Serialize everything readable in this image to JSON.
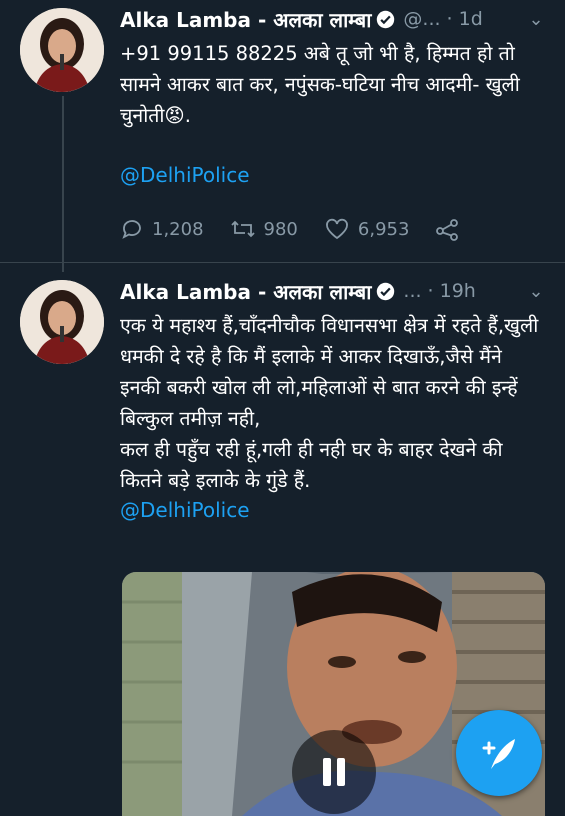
{
  "colors": {
    "background": "#15202b",
    "link": "#1da1f2",
    "muted": "#8899a6",
    "divider": "#38444d"
  },
  "tweets": [
    {
      "name": "Alka Lamba - अलका लाम्बा",
      "handle": "@...",
      "time": "· 1d",
      "text": "+91 99115 88225 अबे तू जो भी है, हिम्मत हो तो सामने आकर बात कर, नपुंसक-घटिया नीच आदमी- खुली चुनोती😡.",
      "mention": "@DelhiPolice",
      "replies": "1,208",
      "retweets": "980",
      "likes": "6,953"
    },
    {
      "name": "Alka Lamba - अलका लाम्बा",
      "handle": "...",
      "time": "· 19h",
      "text": "एक ये महाश्य हैं,चाँदनीचौक विधानसभा क्षेत्र में रहते हैं,खुली धमकी दे रहे है कि मैं इलाके में आकर दिखाऊँ,जैसे मैंने इनकी बकरी खोल ली लो,महिलाओं से बात करने की इन्हें बिल्कुल तमीज़ नही,\nकल ही पहुँच रही हूं,गली ही नही घर के बाहर देखने की कितने बड़े इलाके के गुंडे हैं.",
      "mention": "@DelhiPolice"
    }
  ]
}
